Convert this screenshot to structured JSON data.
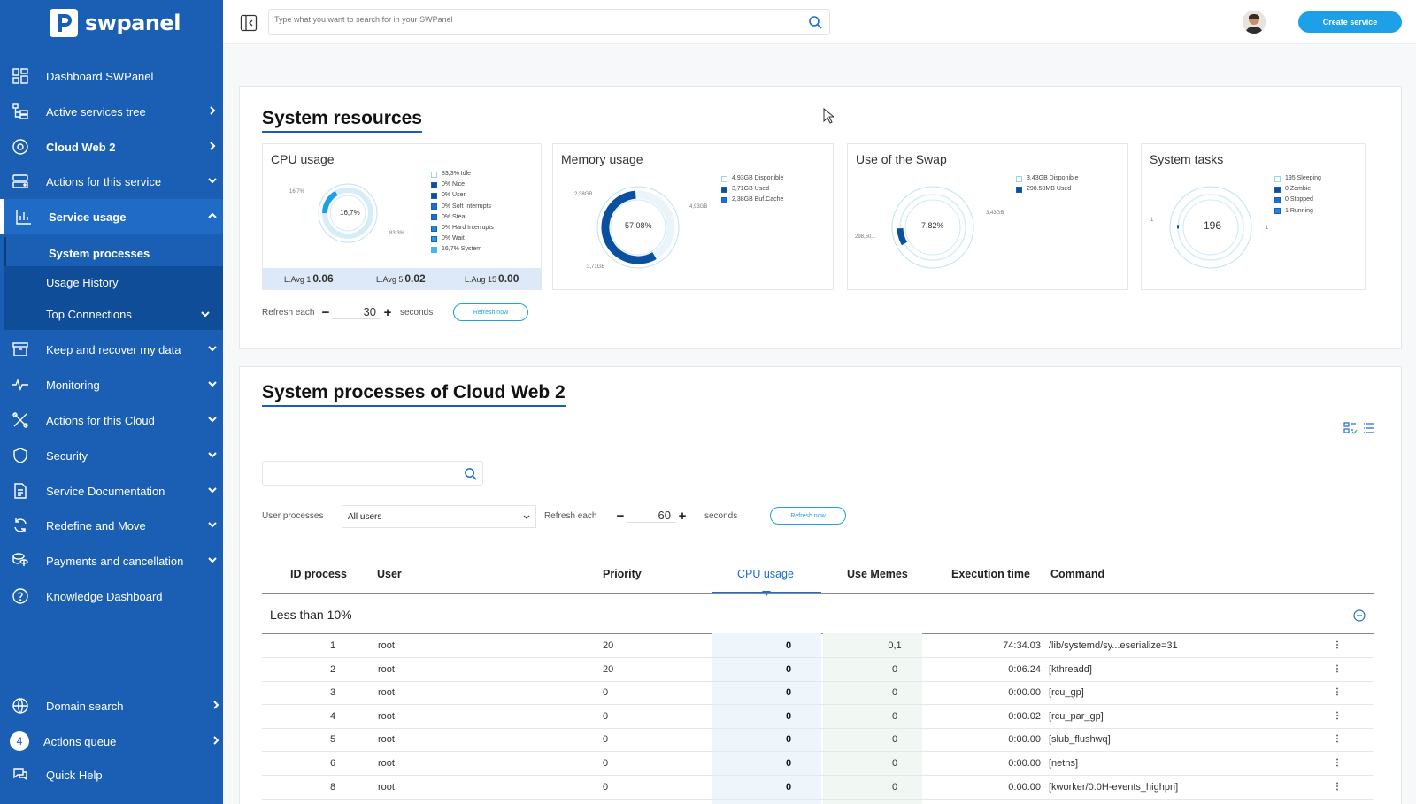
{
  "brand": {
    "name": "swpanel"
  },
  "sidebar": {
    "items": [
      {
        "label": "Dashboard SWPanel",
        "icon": "dashboard-icon"
      },
      {
        "label": "Active services tree",
        "icon": "tree-icon"
      },
      {
        "label": "Cloud Web 2",
        "icon": "cloud-icon"
      },
      {
        "label": "Actions for this service",
        "icon": "server-icon"
      },
      {
        "label": "Service usage",
        "icon": "bar-chart-icon"
      },
      {
        "label": "Keep and recover my data",
        "icon": "archive-icon"
      },
      {
        "label": "Monitoring",
        "icon": "pulse-icon"
      },
      {
        "label": "Actions for this Cloud",
        "icon": "tools-icon"
      },
      {
        "label": "Security",
        "icon": "shield-icon"
      },
      {
        "label": "Service Documentation",
        "icon": "document-icon"
      },
      {
        "label": "Redefine and Move",
        "icon": "refresh-icon"
      },
      {
        "label": "Payments and cancellation",
        "icon": "coins-icon"
      },
      {
        "label": "Knowledge Dashboard",
        "icon": "help-icon"
      },
      {
        "label": "Domain search",
        "icon": "globe-icon"
      },
      {
        "label": "Actions queue",
        "icon": "queue-icon"
      },
      {
        "label": "Quick Help",
        "icon": "chat-icon"
      }
    ],
    "subitems": [
      "System processes",
      "Usage History",
      "Top Connections"
    ],
    "queue_count": "4"
  },
  "topbar": {
    "search_placeholder": "Type what you want to search for in your SWPanel",
    "create_label": "Create service"
  },
  "resources": {
    "title": "System resources",
    "cpu": {
      "title": "CPU usage",
      "center": "16,7%",
      "left": "16,7%",
      "right": "83,3%",
      "legend": [
        "83,3% Idle",
        "0% Nice",
        "0% User",
        "0% Soft Interrupts",
        "0% Steal",
        "0% Hard Interrupts",
        "0% Wait",
        "16,7% System"
      ],
      "lavg": [
        {
          "label": "L.Avg 1",
          "value": "0.06"
        },
        {
          "label": "L.Avg 5",
          "value": "0.02"
        },
        {
          "label": "L.Aug 15",
          "value": "0.00"
        }
      ]
    },
    "memory": {
      "title": "Memory usage",
      "center": "57,08%",
      "left": "2,38GB",
      "right": "4,93GB",
      "bottom": "3,71GB",
      "legend": [
        "4,93GB Disponible",
        "3,71GB Used",
        "2,38GB Buf.Cache"
      ]
    },
    "swap": {
      "title": "Use of the Swap",
      "center": "7,82%",
      "left": "298,50...",
      "right": "3,43GB",
      "legend": [
        "3,43GB Disponible",
        "298.50MB Used"
      ]
    },
    "tasks": {
      "title": "System tasks",
      "center": "196",
      "left": "1",
      "right": "1",
      "legend": [
        "195 Sleeping",
        "0 Zombie",
        "0 Stopped",
        "1 Running"
      ]
    },
    "refresh": {
      "label": "Refresh each",
      "value": "30",
      "unit": "seconds",
      "button": "Refresh now"
    }
  },
  "processes": {
    "title": "System processes of Cloud Web 2",
    "filter_label": "User processes",
    "filter_value": "All users",
    "refresh": {
      "label": "Refresh each",
      "value": "60",
      "unit": "seconds",
      "button": "Refresh now"
    },
    "columns": [
      "ID process",
      "User",
      "Priority",
      "CPU usage",
      "Use Memes",
      "Execution time",
      "Command"
    ],
    "group": "Less than 10%",
    "rows": [
      {
        "id": "1",
        "user": "root",
        "priority": "20",
        "cpu": "0",
        "mem": "0,1",
        "time": "74:34.03",
        "cmd": "/lib/systemd/sy...eserialize=31"
      },
      {
        "id": "2",
        "user": "root",
        "priority": "20",
        "cpu": "0",
        "mem": "0",
        "time": "0:06.24",
        "cmd": "[kthreadd]"
      },
      {
        "id": "3",
        "user": "root",
        "priority": "0",
        "cpu": "0",
        "mem": "0",
        "time": "0:00.00",
        "cmd": "[rcu_gp]"
      },
      {
        "id": "4",
        "user": "root",
        "priority": "0",
        "cpu": "0",
        "mem": "0",
        "time": "0:00.02",
        "cmd": "[rcu_par_gp]"
      },
      {
        "id": "5",
        "user": "root",
        "priority": "0",
        "cpu": "0",
        "mem": "0",
        "time": "0:00.00",
        "cmd": "[slub_flushwq]"
      },
      {
        "id": "6",
        "user": "root",
        "priority": "0",
        "cpu": "0",
        "mem": "0",
        "time": "0:00.00",
        "cmd": "[netns]"
      },
      {
        "id": "8",
        "user": "root",
        "priority": "0",
        "cpu": "0",
        "mem": "0",
        "time": "0:00.00",
        "cmd": "[kworker/0:0H-events_highpri]"
      }
    ]
  },
  "colors": {
    "brand": "#1a5fb4",
    "accent": "#1ea0e8",
    "chart": "#0b4fa0"
  }
}
